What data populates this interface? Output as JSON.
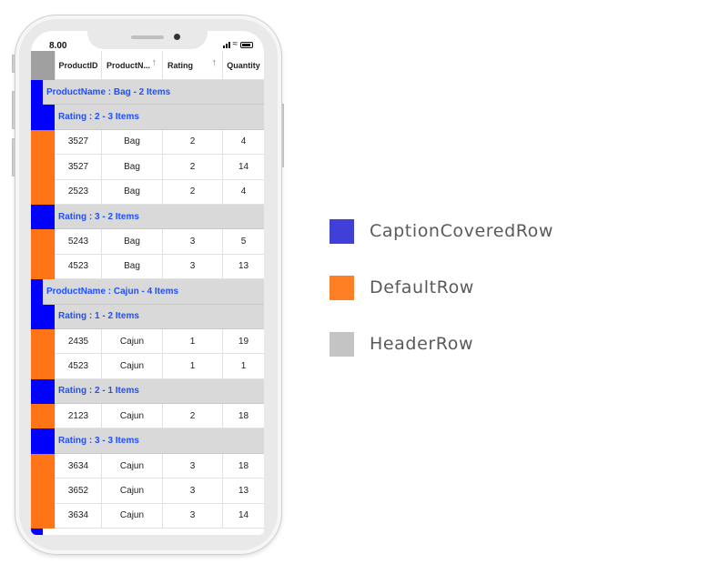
{
  "status_bar": {
    "time": "8.00"
  },
  "colors": {
    "caption_covered": "#0000ff",
    "default_row": "#ff7417",
    "header_row": "#a0a0a0"
  },
  "grid": {
    "columns": [
      {
        "label": "ProductID",
        "sort": ""
      },
      {
        "label": "ProductN...",
        "sort": "↑"
      },
      {
        "label": "Rating",
        "sort": "↑"
      },
      {
        "label": "Quantity",
        "sort": ""
      }
    ],
    "rows": [
      {
        "type": "caption",
        "level": 1,
        "text": "ProductName : Bag - 2 Items"
      },
      {
        "type": "caption",
        "level": 2,
        "text": "Rating : 2 - 3 Items"
      },
      {
        "type": "data",
        "cells": [
          "3527",
          "Bag",
          "2",
          "4"
        ]
      },
      {
        "type": "data",
        "cells": [
          "3527",
          "Bag",
          "2",
          "14"
        ]
      },
      {
        "type": "data",
        "cells": [
          "2523",
          "Bag",
          "2",
          "4"
        ]
      },
      {
        "type": "caption",
        "level": 2,
        "text": "Rating : 3 - 2 Items"
      },
      {
        "type": "data",
        "cells": [
          "5243",
          "Bag",
          "3",
          "5"
        ]
      },
      {
        "type": "data",
        "cells": [
          "4523",
          "Bag",
          "3",
          "13"
        ]
      },
      {
        "type": "caption",
        "level": 1,
        "text": "ProductName : Cajun - 4 Items"
      },
      {
        "type": "caption",
        "level": 2,
        "text": "Rating : 1 - 2 Items"
      },
      {
        "type": "data",
        "cells": [
          "2435",
          "Cajun",
          "1",
          "19"
        ]
      },
      {
        "type": "data",
        "cells": [
          "4523",
          "Cajun",
          "1",
          "1"
        ]
      },
      {
        "type": "caption",
        "level": 2,
        "text": "Rating : 2 - 1 Items"
      },
      {
        "type": "data",
        "cells": [
          "2123",
          "Cajun",
          "2",
          "18"
        ]
      },
      {
        "type": "caption",
        "level": 2,
        "text": "Rating : 3 - 3 Items"
      },
      {
        "type": "data",
        "cells": [
          "3634",
          "Cajun",
          "3",
          "18"
        ]
      },
      {
        "type": "data",
        "cells": [
          "3652",
          "Cajun",
          "3",
          "13"
        ]
      },
      {
        "type": "data",
        "cells": [
          "3634",
          "Cajun",
          "3",
          "14"
        ]
      }
    ]
  },
  "legend": [
    {
      "label": "CaptionCoveredRow",
      "color": "#4040d8"
    },
    {
      "label": "DefaultRow",
      "color": "#ff7f24"
    },
    {
      "label": "HeaderRow",
      "color": "#c4c4c4"
    }
  ]
}
